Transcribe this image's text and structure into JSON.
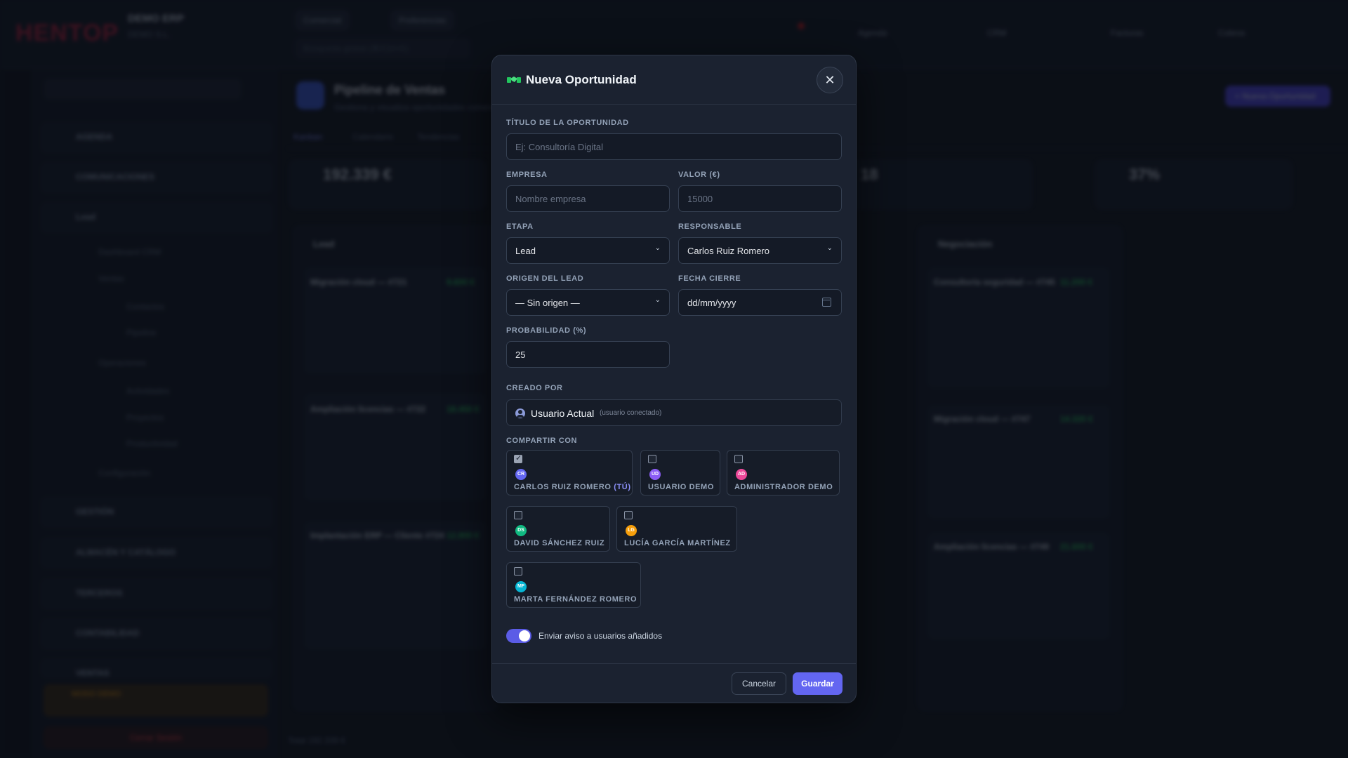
{
  "background": {
    "logo": "HENTOP",
    "company_name": "DEMO ERP",
    "company_sub": "DEMO S.L.",
    "top_chip_1": "Comercial",
    "top_chip_2": "Preferencias",
    "search_placeholder": "Búsqueda global (⌘/Ctrl+K)",
    "top_links": [
      "Agenda",
      "CRM",
      "Facturas",
      "Cobros"
    ],
    "sidebar_blocks": [
      "AGENDA",
      "COMUNICACIONES",
      "Lead",
      "GESTIÓN",
      "ALMACÉN Y CATÁLOGO",
      "TERCEROS",
      "CONTABILIDAD",
      "VENTAS"
    ],
    "sidebar_subs": [
      "Dashboard CRM",
      "Ventas",
      "Contactos",
      "Pipeline",
      "Operaciones",
      "Actividades",
      "Proyectos",
      "Productividad",
      "Configuración"
    ],
    "demo_label": "MODO DEMO",
    "logout_label": "Cerrar Sesión",
    "page_title": "Pipeline de Ventas",
    "page_subtitle": "Gestiona y visualiza oportunidades comerciales",
    "tabs": [
      "Kanban",
      "Calendario",
      "Tendencias"
    ],
    "stats": [
      "192.339 €",
      "18",
      "37%"
    ],
    "columns": [
      "Lead",
      "Negociación"
    ],
    "cards": [
      {
        "title": "Migración cloud — #721",
        "amount": "9.600 €"
      },
      {
        "title": "Ampliación licencias — #722",
        "amount": "18.450 €"
      },
      {
        "title": "Implantación ERP — Cliente #724",
        "amount": "12.800 €"
      },
      {
        "title": "Consultoría seguridad — #745",
        "amount": "11.200 €"
      },
      {
        "title": "Migración cloud — #747",
        "amount": "14.320 €"
      },
      {
        "title": "Ampliación licencias — #749",
        "amount": "21.600 €"
      }
    ],
    "new_button": "+ Nueva Oportunidad",
    "footer_total": "Total 192.339 €"
  },
  "modal": {
    "title": "Nueva Oportunidad",
    "close_glyph": "✕",
    "fields": {
      "title_label": "TÍTULO DE LA OPORTUNIDAD",
      "title_placeholder": "Ej: Consultoría Digital",
      "company_label": "EMPRESA",
      "company_placeholder": "Nombre empresa",
      "value_label": "VALOR (€)",
      "value_placeholder": "15000",
      "stage_label": "ETAPA",
      "stage_value": "Lead",
      "owner_label": "RESPONSABLE",
      "owner_value": "Carlos Ruiz Romero",
      "origin_label": "ORIGEN DEL LEAD",
      "origin_value": "— Sin origen —",
      "close_date_label": "FECHA CIERRE",
      "close_date_value": "dd/mm/yyyy",
      "probability_label": "PROBABILIDAD (%)",
      "probability_value": "25"
    },
    "created_by": {
      "label": "CREADO POR",
      "name": "Usuario Actual",
      "note": "(usuario conectado)"
    },
    "share": {
      "label": "COMPARTIR CON",
      "users": [
        {
          "initials": "CR",
          "name": "CARLOS RUIZ ROMERO",
          "suffix": "(TÚ)",
          "checked": true,
          "color": "#6366f1"
        },
        {
          "initials": "UD",
          "name": "USUARIO DEMO",
          "suffix": "",
          "checked": false,
          "color": "#8b5cf6"
        },
        {
          "initials": "AD",
          "name": "ADMINISTRADOR DEMO",
          "suffix": "",
          "checked": false,
          "color": "#ec4899"
        },
        {
          "initials": "DS",
          "name": "DAVID SÁNCHEZ RUIZ",
          "suffix": "",
          "checked": false,
          "color": "#10b981"
        },
        {
          "initials": "LG",
          "name": "LUCÍA GARCÍA MARTÍNEZ",
          "suffix": "",
          "checked": false,
          "color": "#f59e0b"
        },
        {
          "initials": "MF",
          "name": "MARTA FERNÁNDEZ ROMERO",
          "suffix": "",
          "checked": false,
          "color": "#06b6d4"
        }
      ]
    },
    "notify": {
      "label": "Enviar aviso a usuarios añadidos",
      "enabled": true
    },
    "buttons": {
      "cancel": "Cancelar",
      "save": "Guardar"
    },
    "colors": {
      "accent": "#6366f1",
      "modal_bg": "#1b2230"
    }
  }
}
